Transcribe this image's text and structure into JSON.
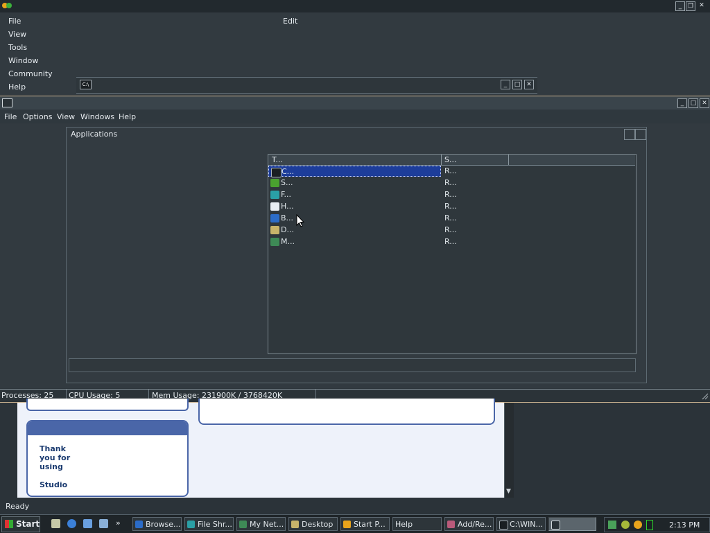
{
  "main_window": {
    "menu": [
      "File",
      "View",
      "Tools",
      "Window",
      "Community",
      "Help"
    ],
    "edit_label": "Edit"
  },
  "cmd_window": {
    "icon_text": "C:\\"
  },
  "task_manager": {
    "menu": [
      "File",
      "Options",
      "View",
      "Windows",
      "Help"
    ],
    "tab_label": "Applications",
    "columns": [
      "T...",
      "S..."
    ],
    "rows": [
      {
        "task": "C...",
        "status": "R...",
        "icon": "cmd-icon",
        "color": "#3b4f8c"
      },
      {
        "task": "S...",
        "status": "R...",
        "icon": "studio-icon",
        "color": "#4aa22f"
      },
      {
        "task": "F...",
        "status": "R...",
        "icon": "file-share-icon",
        "color": "#2aa0a6"
      },
      {
        "task": "H...",
        "status": "R...",
        "icon": "help-window-icon",
        "color": "#e8eef3"
      },
      {
        "task": "B...",
        "status": "R...",
        "icon": "browser-icon",
        "color": "#2b6cc8"
      },
      {
        "task": "D...",
        "status": "R...",
        "icon": "desktop-folder-icon",
        "color": "#c8b46a"
      },
      {
        "task": "M...",
        "status": "R...",
        "icon": "my-network-icon",
        "color": "#3e8a56"
      }
    ],
    "status": {
      "processes": "Processes: 25",
      "cpu": "CPU Usage: 5",
      "mem": "Mem Usage: 231900K / 3768420K"
    }
  },
  "web_page": {
    "thank_you": [
      "Thank",
      "you for",
      "using"
    ],
    "studio": "Studio",
    "status": "Ready"
  },
  "taskbar": {
    "start": "Start",
    "buttons": [
      "Browse...",
      "File Shr...",
      "My Net...",
      "Desktop",
      "Start P...",
      "Help",
      "Add/Re...",
      "C:\\WIN..."
    ],
    "clock": "2:13 PM"
  }
}
